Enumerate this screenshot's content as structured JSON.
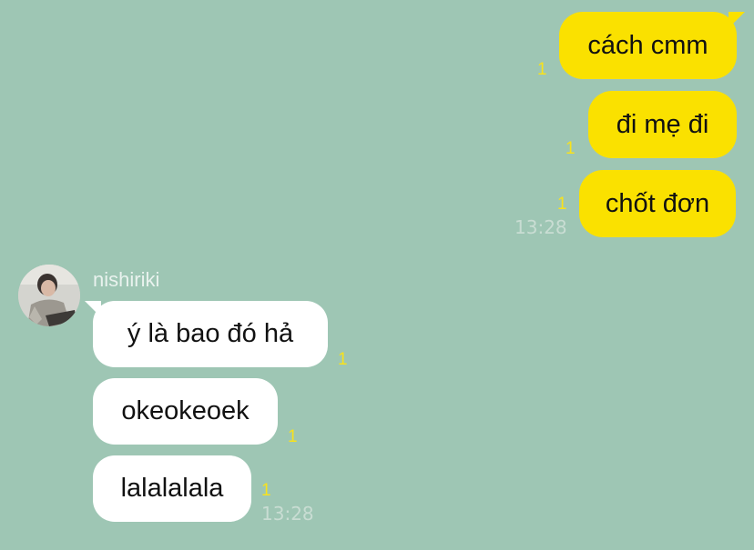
{
  "chat": {
    "outgoing": [
      {
        "text": "cách cmm",
        "unread": "1"
      },
      {
        "text": "đi mẹ đi",
        "unread": "1"
      },
      {
        "text": "chốt đơn",
        "unread": "1",
        "time": "13:28"
      }
    ],
    "incoming_sender": "nishiriki",
    "incoming": [
      {
        "text": "ý là bao đó hả",
        "unread": "1"
      },
      {
        "text": "okeokeoek",
        "unread": "1"
      },
      {
        "text": "lalalalala",
        "unread": "1",
        "time": "13:28"
      }
    ]
  },
  "colors": {
    "background": "#9ec6b4",
    "outgoing_bubble": "#fae100",
    "incoming_bubble": "#ffffff",
    "unread_count": "#f8e21c"
  },
  "icons": {
    "avatar": "profile-photo"
  }
}
